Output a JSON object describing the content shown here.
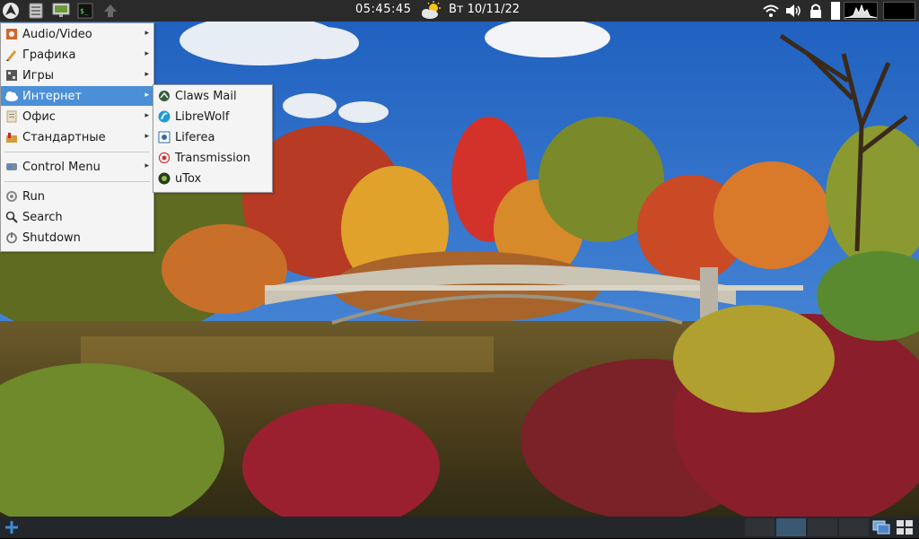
{
  "top_panel": {
    "clock": "05:45:45",
    "date": "Вт 10/11/22",
    "icons": [
      "system-logo-icon",
      "file-manager-icon",
      "monitor-icon",
      "terminal-icon",
      "upload-arrow-icon",
      "weather-partly-cloudy-icon",
      "wifi-icon",
      "volume-icon",
      "lock-icon",
      "cpu-graph-icon",
      "memory-graph-icon"
    ]
  },
  "main_menu": {
    "items": [
      {
        "label": "Audio/Video",
        "icon": "audio-video-icon",
        "has_submenu": true
      },
      {
        "label": "Графика",
        "icon": "graphics-icon",
        "has_submenu": true
      },
      {
        "label": "Игры",
        "icon": "games-icon",
        "has_submenu": true
      },
      {
        "label": "Интернет",
        "icon": "internet-icon",
        "has_submenu": true,
        "active": true
      },
      {
        "label": "Офис",
        "icon": "office-icon",
        "has_submenu": true
      },
      {
        "label": "Стандартные",
        "icon": "accessories-icon",
        "has_submenu": true
      },
      {
        "label": "Control Menu",
        "icon": "control-menu-icon",
        "has_submenu": true
      },
      {
        "label": "Run",
        "icon": "run-icon",
        "has_submenu": false
      },
      {
        "label": "Search",
        "icon": "search-icon",
        "has_submenu": false
      },
      {
        "label": "Shutdown",
        "icon": "shutdown-icon",
        "has_submenu": false
      }
    ]
  },
  "internet_submenu": {
    "items": [
      {
        "label": "Claws Mail",
        "icon": "claws-mail-icon"
      },
      {
        "label": "LibreWolf",
        "icon": "librewolf-icon"
      },
      {
        "label": "Liferea",
        "icon": "liferea-icon"
      },
      {
        "label": "Transmission",
        "icon": "transmission-icon"
      },
      {
        "label": "uTox",
        "icon": "utox-icon"
      }
    ]
  },
  "bottom_panel": {
    "desktops": 4,
    "active_desktop": 2,
    "icons": [
      "add-plus-icon",
      "show-desktop-icon",
      "window-switch-icon"
    ]
  },
  "colors": {
    "panel": "#2a2a2a",
    "menu_bg": "#f4f4f4",
    "highlight": "#4a8fd8",
    "sky": "#2d6fc4"
  }
}
